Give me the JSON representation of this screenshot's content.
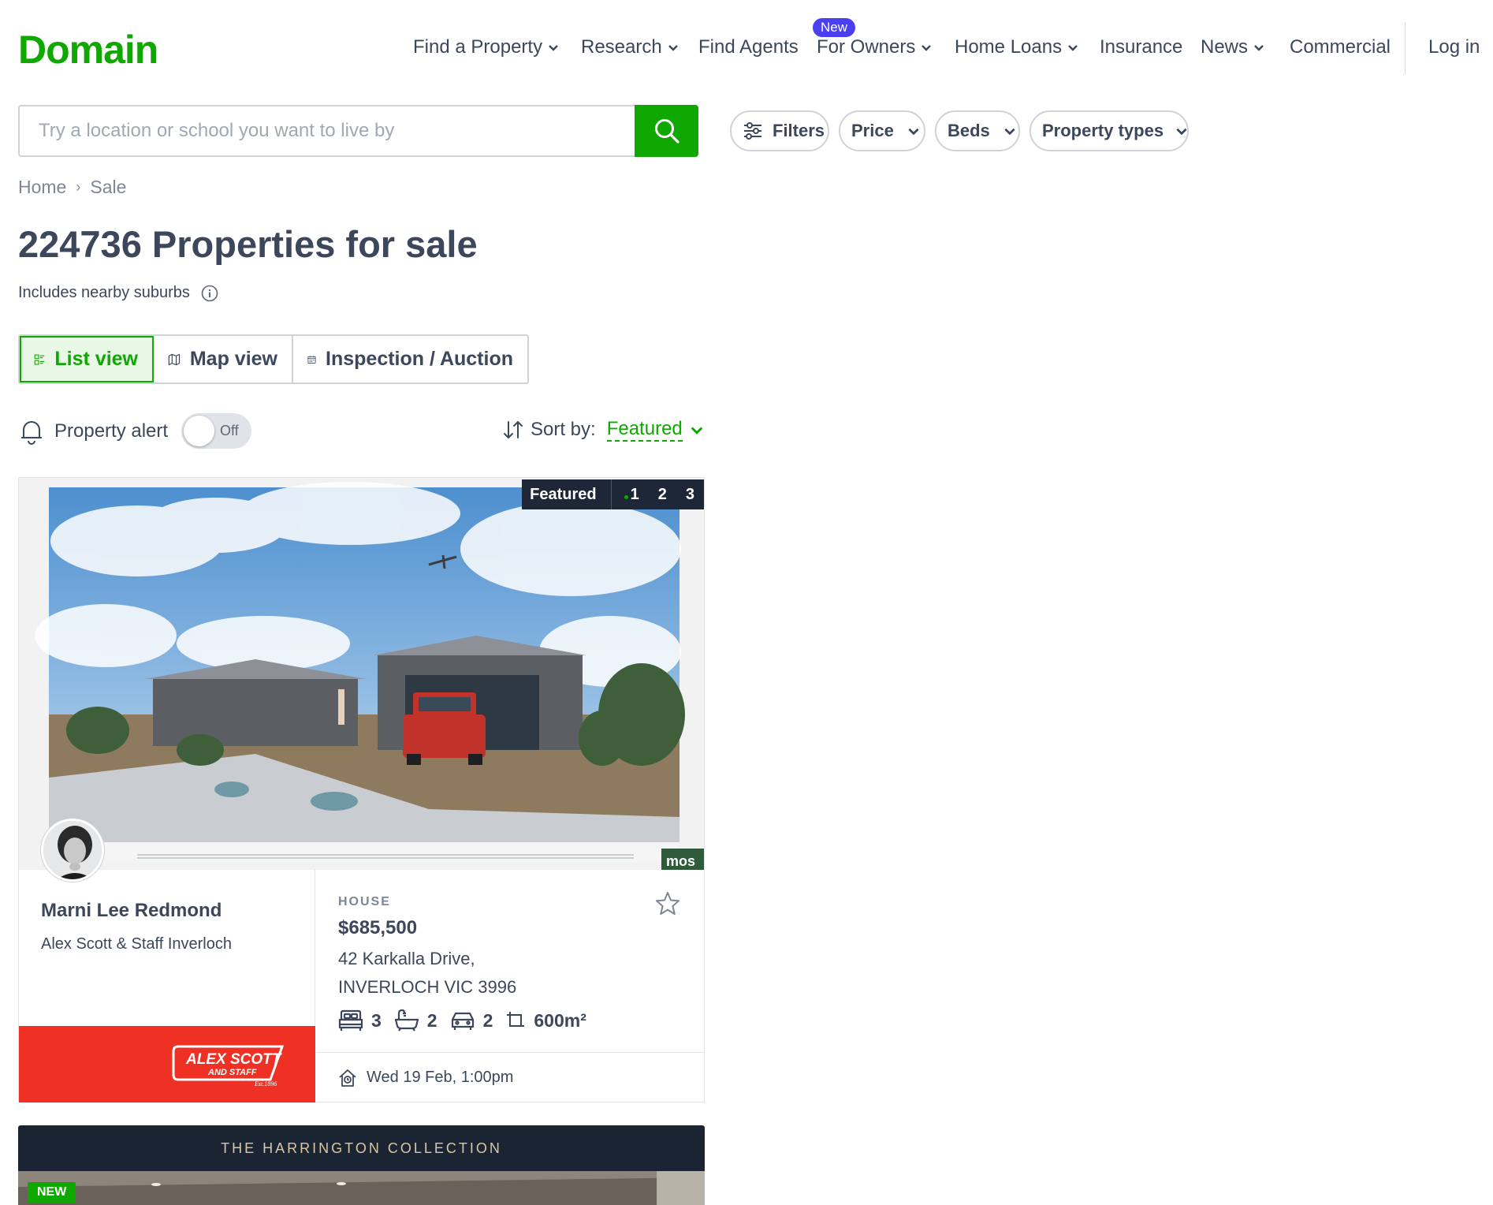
{
  "brand": {
    "logo_text": "Domain",
    "accent": "#0ea800",
    "badge_color": "#4b3ff2"
  },
  "nav": {
    "items": [
      {
        "label": "Find a Property",
        "has_dropdown": true
      },
      {
        "label": "Research",
        "has_dropdown": true
      },
      {
        "label": "Find Agents",
        "has_dropdown": false
      },
      {
        "label": "For Owners",
        "has_dropdown": true,
        "badge": "New"
      },
      {
        "label": "Home Loans",
        "has_dropdown": true
      },
      {
        "label": "Insurance",
        "has_dropdown": false
      },
      {
        "label": "News",
        "has_dropdown": true
      },
      {
        "label": "Commercial",
        "has_dropdown": false
      }
    ],
    "login": "Log in"
  },
  "search": {
    "placeholder": "Try a location or school you want to live by",
    "value": "",
    "icon": "search-icon",
    "filters": [
      {
        "label": "Filters",
        "icon": "sliders-icon"
      },
      {
        "label": "Price",
        "icon": "chevron-down-icon"
      },
      {
        "label": "Beds",
        "icon": "chevron-down-icon"
      },
      {
        "label": "Property types",
        "icon": "chevron-down-icon"
      }
    ]
  },
  "breadcrumb": {
    "home": "Home",
    "separator": "›",
    "current": "Sale"
  },
  "results": {
    "title": "224736 Properties for sale",
    "subtitle": "Includes nearby suburbs"
  },
  "view_tabs": [
    {
      "label": "List view",
      "active": true,
      "icon": "list-icon"
    },
    {
      "label": "Map view",
      "active": false,
      "icon": "map-icon"
    },
    {
      "label": "Inspection / Auction",
      "active": false,
      "icon": "calendar-icon"
    }
  ],
  "alert": {
    "label": "Property alert",
    "toggle_state": "Off",
    "enabled": false
  },
  "sort": {
    "label": "Sort by:",
    "value": "Featured"
  },
  "listing": {
    "featured_label": "Featured",
    "carousel": {
      "pages": [
        "1",
        "2",
        "3"
      ],
      "active": "1"
    },
    "agent": {
      "name": "Marni Lee Redmond",
      "agency": "Alex Scott & Staff Inverloch",
      "agency_color": "#ee3124",
      "logo_line1": "ALEX SCOTT",
      "logo_line2": "AND STAFF",
      "logo_line3": "Est.1896"
    },
    "property_type": "HOUSE",
    "price": "$685,500",
    "address_line1": "42 Karkalla Drive,",
    "address_line2": "INVERLOCH VIC 3996",
    "features": {
      "beds": "3",
      "baths": "2",
      "parking": "2",
      "land": "600m²"
    },
    "inspection": "Wed 19 Feb, 1:00pm",
    "image_watermark": "mos"
  },
  "listing2": {
    "banner": "THE HARRINGTON COLLECTION",
    "tag": "NEW"
  }
}
